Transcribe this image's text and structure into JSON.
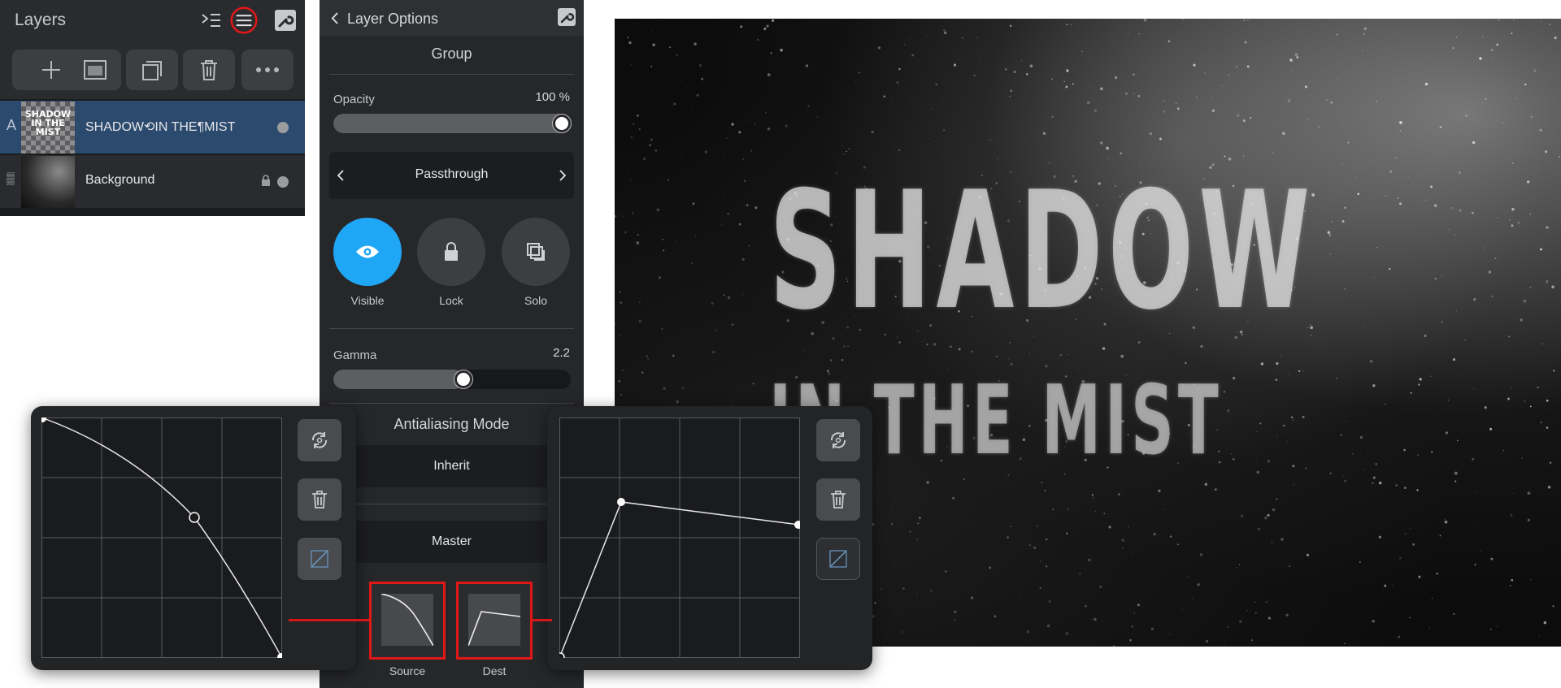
{
  "layers_panel": {
    "title": "Layers",
    "header_icons": [
      "layer-tree-icon",
      "menu-icon",
      "wrench-icon"
    ],
    "toolbar_icons": [
      "add-icon",
      "mask-icon",
      "group-icon",
      "trash-icon",
      "more-icon"
    ],
    "layers": [
      {
        "name": "SHADOW⟲IN THE¶MIST",
        "indicator": "A",
        "thumb_text": "SHADOW IN THE MIST",
        "selected": true
      },
      {
        "name": "Background",
        "indicator": "▒",
        "locked": true,
        "selected": false
      }
    ]
  },
  "layer_options": {
    "back_label": "Layer Options",
    "type_label": "Group",
    "opacity": {
      "label": "Opacity",
      "value_text": "100 %",
      "value": 100
    },
    "blend_mode": "Passthrough",
    "toggles": [
      {
        "label": "Visible",
        "active": true
      },
      {
        "label": "Lock",
        "active": false
      },
      {
        "label": "Solo",
        "active": false
      }
    ],
    "gamma": {
      "label": "Gamma",
      "value_text": "2.2",
      "value": 2.2
    },
    "antialiasing": {
      "label": "Antialiasing Mode",
      "value": "Inherit"
    },
    "master_label": "Master",
    "source_label": "Source",
    "dest_label": "Dest"
  },
  "canvas_art": {
    "line1": "SHADOW",
    "line2": "IN THE MIST"
  },
  "colors": {
    "accent": "#1fa6f5",
    "highlight_red": "#e01818",
    "selected_row": "#2c4a6e"
  }
}
